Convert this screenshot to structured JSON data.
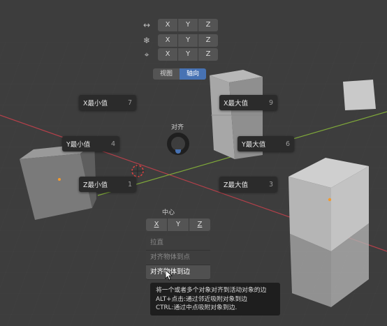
{
  "axis_rows": [
    {
      "icon": "move-arrows-icon",
      "glyph": "↔",
      "buttons": [
        "X",
        "Y",
        "Z"
      ]
    },
    {
      "icon": "snowflake-icon",
      "glyph": "❄",
      "buttons": [
        "X",
        "Y",
        "Z"
      ]
    },
    {
      "icon": "target-icon",
      "glyph": "⌖",
      "buttons": [
        "X",
        "Y",
        "Z"
      ]
    }
  ],
  "mode_tabs": {
    "view": "视图",
    "axis": "轴向",
    "active": "axis"
  },
  "pie": {
    "title": "对齐",
    "x_min": {
      "label": "X最小值",
      "key": "7"
    },
    "x_max": {
      "label": "X最大值",
      "key": "9"
    },
    "y_min": {
      "label": "Y最小值",
      "key": "4"
    },
    "y_max": {
      "label": "Y最大值",
      "key": "6"
    },
    "z_min": {
      "label": "Z最小值",
      "key": "1"
    },
    "z_max": {
      "label": "Z最大值",
      "key": "3"
    }
  },
  "center": {
    "label": "中心",
    "buttons": [
      "X",
      "Y",
      "Z"
    ]
  },
  "menu": {
    "items": [
      "拉直",
      "对齐物体到点",
      "对齐物体到边"
    ],
    "hovered_index": 2
  },
  "tooltip": {
    "line1": "将一个或者多个对象对齐到活动对象的边",
    "line2": "ALT+点击:通过邻近吸附对象到边",
    "line3": "CTRL:通过中点吸附对象到边."
  },
  "colors": {
    "accent": "#4772b3",
    "x_axis": "#b3404a",
    "y_axis": "#7fa83a",
    "origin": "#f29b2f"
  }
}
